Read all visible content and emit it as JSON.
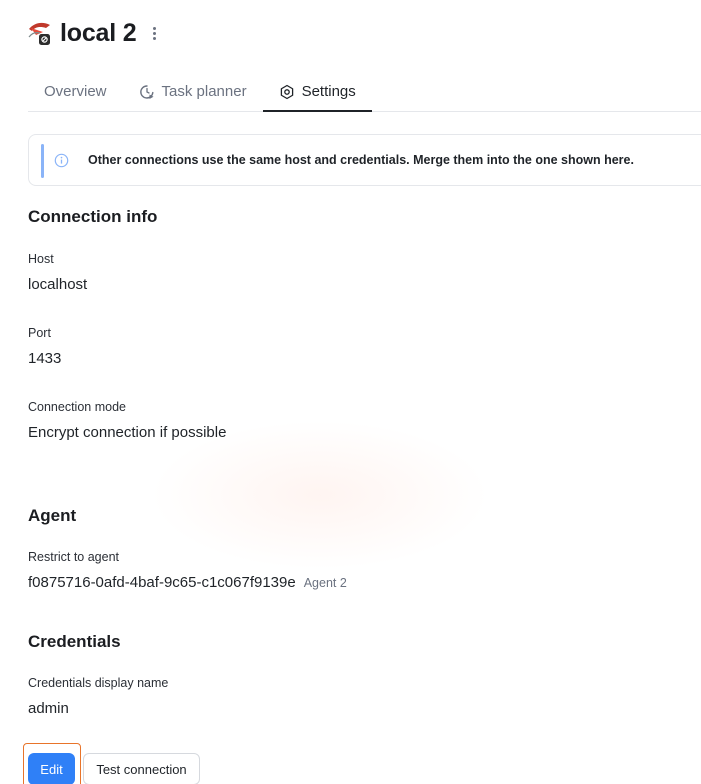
{
  "header": {
    "title": "local 2",
    "icon": "sql-server-database-icon"
  },
  "tabs": [
    {
      "label": "Overview",
      "icon": "",
      "active": false
    },
    {
      "label": "Task planner",
      "icon": "clock-play-icon",
      "active": false
    },
    {
      "label": "Settings",
      "icon": "gear-icon",
      "active": true
    }
  ],
  "banner": {
    "text": "Other connections use the same host and credentials. Merge them into the one shown here.",
    "icon": "info-icon"
  },
  "connection_info": {
    "title": "Connection info",
    "host_label": "Host",
    "host_value": "localhost",
    "port_label": "Port",
    "port_value": "1433",
    "mode_label": "Connection mode",
    "mode_value": "Encrypt connection if possible"
  },
  "agent": {
    "title": "Agent",
    "restrict_label": "Restrict to agent",
    "agent_id": "f0875716-0afd-4baf-9c65-c1c067f9139e",
    "agent_name": "Agent 2"
  },
  "credentials": {
    "title": "Credentials",
    "display_name_label": "Credentials display name",
    "display_name_value": "admin"
  },
  "actions": {
    "edit_label": "Edit",
    "test_label": "Test connection"
  },
  "colors": {
    "accent": "#2f80f7",
    "highlight": "#e8742a",
    "banner_bar": "#8ab4f8"
  }
}
